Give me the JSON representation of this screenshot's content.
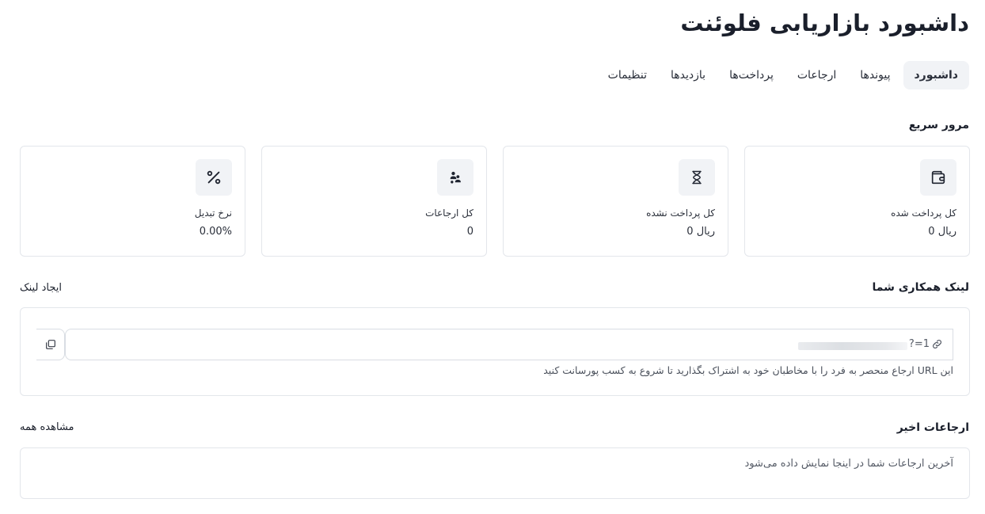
{
  "header": {
    "title": "داشبورد بازاریابی فلوئنت"
  },
  "tabs": [
    {
      "label": "داشبورد",
      "active": true
    },
    {
      "label": "پیوندها",
      "active": false
    },
    {
      "label": "ارجاعات",
      "active": false
    },
    {
      "label": "پرداخت‌ها",
      "active": false
    },
    {
      "label": "بازدیدها",
      "active": false
    },
    {
      "label": "تنظیمات",
      "active": false
    }
  ],
  "overview": {
    "title": "مرور سریع",
    "cards": [
      {
        "icon": "wallet-icon",
        "label": "کل پرداخت شده",
        "value": "ریال 0"
      },
      {
        "icon": "hourglass-icon",
        "label": "کل پرداخت نشده",
        "value": "ریال 0"
      },
      {
        "icon": "users-icon",
        "label": "کل ارجاعات",
        "value": "0"
      },
      {
        "icon": "percent-icon",
        "label": "نرخ تبدیل",
        "value": "0.00%"
      }
    ]
  },
  "affiliate_link": {
    "title": "لینک همکاری شما",
    "create_label": "ایجاد لینک",
    "url_text": "?=1",
    "hint": "این URL ارجاع منحصر به فرد را با مخاطبان خود به اشتراک بگذارید تا شروع به کسب پورسانت کنید"
  },
  "recent_referrals": {
    "title": "ارجاعات اخیر",
    "view_all_label": "مشاهده همه",
    "empty_text": "آخرین ارجاعات شما در اینجا نمایش داده می‌شود"
  },
  "colors": {
    "text": "#1f2430",
    "border": "#e3e6eb",
    "icon_bg": "#f1f3f6",
    "tab_active_bg": "#f1f3f6"
  }
}
